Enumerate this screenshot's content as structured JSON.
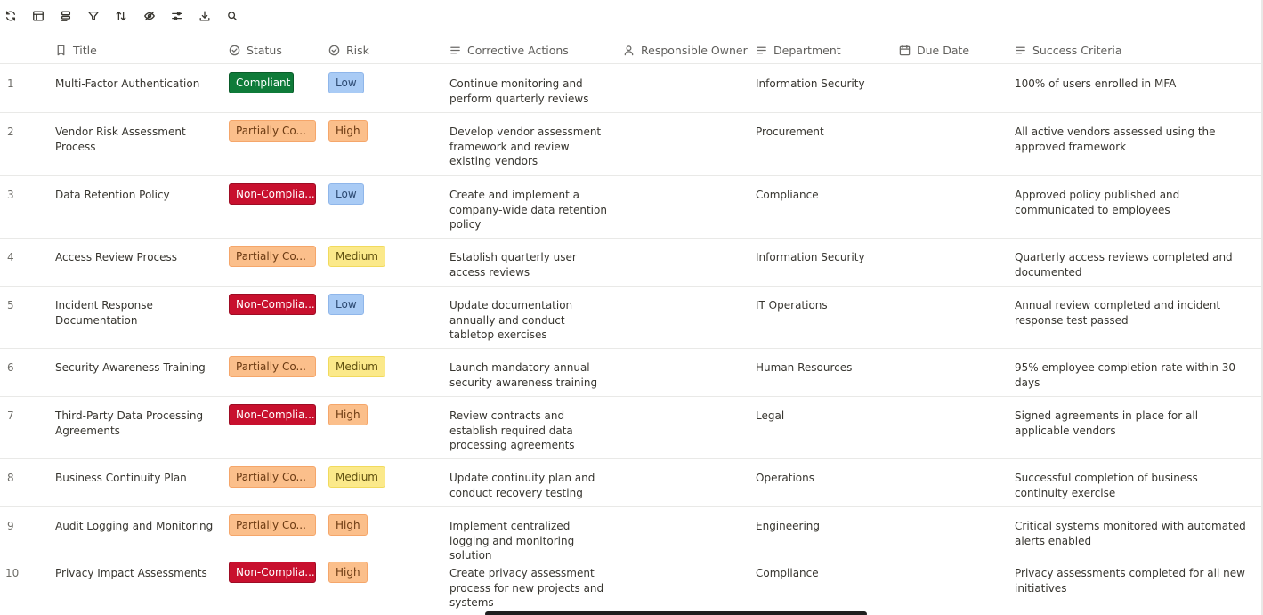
{
  "toolbar": {
    "icons": [
      "refresh-icon",
      "layout-icon",
      "group-icon",
      "filter-icon",
      "sort-icon",
      "hide-fields-icon",
      "adjust-icon",
      "download-icon",
      "search-icon"
    ]
  },
  "columns": {
    "title": "Title",
    "status": "Status",
    "risk": "Risk",
    "corrective_actions": "Corrective Actions",
    "responsible_owner": "Responsible Owner",
    "department": "Department",
    "due_date": "Due Date",
    "success_criteria": "Success Criteria"
  },
  "rows": [
    {
      "num": "1",
      "title": "Multi-Factor Authentication",
      "status": "Compliant",
      "status_color": "#0f7b39",
      "risk": "Low",
      "action": "Continue monitoring and perform quarterly reviews",
      "owner": "",
      "department": "Information Security",
      "due": "",
      "criteria": "100% of users enrolled in MFA"
    },
    {
      "num": "2",
      "title": "Vendor Risk Assessment Process",
      "status": "Partially Co...",
      "status_color": "#fbbf8b",
      "risk": "High",
      "action": "Develop vendor assessment framework and review existing vendors",
      "owner": "",
      "department": "Procurement",
      "due": "",
      "criteria": "All active vendors assessed using the approved framework"
    },
    {
      "num": "3",
      "title": "Data Retention Policy",
      "status": "Non-Complia...",
      "status_color": "#c8102e",
      "risk": "Low",
      "action": "Create and implement a company-wide data retention policy",
      "owner": "",
      "department": "Compliance",
      "due": "",
      "criteria": "Approved policy published and communicated to employees"
    },
    {
      "num": "4",
      "title": "Access Review Process",
      "status": "Partially Co...",
      "status_color": "#fbbf8b",
      "risk": "Medium",
      "action": "Establish quarterly user access reviews",
      "owner": "",
      "department": "Information Security",
      "due": "",
      "criteria": "Quarterly access reviews completed and documented"
    },
    {
      "num": "5",
      "title": "Incident Response Documentation",
      "status": "Non-Complia...",
      "status_color": "#c8102e",
      "risk": "Low",
      "action": "Update documentation annually and conduct tabletop exercises",
      "owner": "",
      "department": "IT Operations",
      "due": "",
      "criteria": "Annual review completed and incident response test passed"
    },
    {
      "num": "6",
      "title": "Security Awareness Training",
      "status": "Partially Co...",
      "status_color": "#fbbf8b",
      "risk": "Medium",
      "action": "Launch mandatory annual security awareness training",
      "owner": "",
      "department": "Human Resources",
      "due": "",
      "criteria": "95% employee completion rate within 30 days"
    },
    {
      "num": "7",
      "title": "Third-Party Data Processing Agreements",
      "status": "Non-Complia...",
      "status_color": "#c8102e",
      "risk": "High",
      "action": "Review contracts and establish required data processing agreements",
      "owner": "",
      "department": "Legal",
      "due": "",
      "criteria": "Signed agreements in place for all applicable vendors"
    },
    {
      "num": "8",
      "title": "Business Continuity Plan",
      "status": "Partially Co...",
      "status_color": "#fbbf8b",
      "risk": "Medium",
      "action": "Update continuity plan and conduct recovery testing",
      "owner": "",
      "department": "Operations",
      "due": "",
      "criteria": "Successful completion of business continuity exercise"
    },
    {
      "num": "9",
      "title": "Audit Logging and Monitoring",
      "status": "Partially Co...",
      "status_color": "#fbbf8b",
      "risk": "High",
      "action": "Implement centralized logging and monitoring solution",
      "owner": "",
      "department": "Engineering",
      "due": "",
      "criteria": "Critical systems monitored with automated alerts enabled"
    },
    {
      "num": "10",
      "title": "Privacy Impact Assessments",
      "status": "Non-Complia...",
      "status_color": "#c8102e",
      "risk": "High",
      "action": "Create privacy assessment process for new projects and systems",
      "owner": "",
      "department": "Compliance",
      "due": "",
      "criteria": "Privacy assessments completed for all new initiatives"
    }
  ],
  "risk_colors": {
    "Low": "#a9cbf5",
    "Medium": "#fbe98a",
    "High": "#fbbf8b"
  }
}
